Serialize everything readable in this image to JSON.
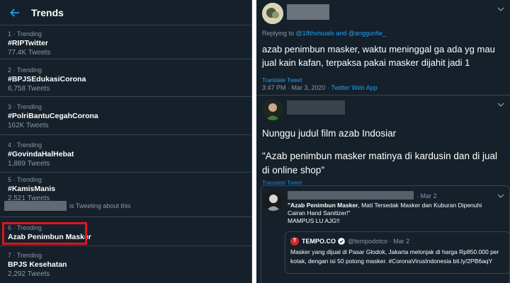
{
  "left": {
    "title": "Trends",
    "trends": [
      {
        "meta": "1 · Trending",
        "name": "#RIPTwitter",
        "count": "77.4K Tweets"
      },
      {
        "meta": "2 · Trending",
        "name": "#BPJSEdukasiCorona",
        "count": "6,758 Tweets"
      },
      {
        "meta": "3 · Trending",
        "name": "#PolriBantuCegahCorona",
        "count": "162K Tweets"
      },
      {
        "meta": "4 · Trending",
        "name": "#GovindaHalHebat",
        "count": "1,889 Tweets"
      },
      {
        "meta": "5 · Trending",
        "name": "#KamisManis",
        "count": "2,521 Tweets",
        "extra": "is Tweeting about this"
      },
      {
        "meta": "6 · Trending",
        "name": "Azab Penimbun Masker",
        "count": ""
      },
      {
        "meta": "7 · Trending",
        "name": "BPJS Kesehatan",
        "count": "2,292 Tweets"
      }
    ]
  },
  "right": {
    "tweet1": {
      "replying_prefix": "Replying to",
      "replying_handles": "@18thvisuals and @anggunfw_",
      "text": "azab penimbun masker, waktu meninggal ga ada yg mau jual kain kafan, terpaksa pakai masker dijahit jadi 1",
      "translate": "Translate Tweet",
      "timestamp": "3:47 PM · Mar 3, 2020 · ",
      "source": "Twitter Web App"
    },
    "tweet2": {
      "line1": "Nunggu judul film azab Indosiar",
      "line2": "\"Azab penimbun masker matinya di kardusin dan di jual di online shop\"",
      "translate": "Translate Tweet"
    },
    "quote": {
      "date": "· Mar 2",
      "bold": "\"Azab Penimbun Masker",
      "text": ", Mati Tersedak Masker dan Kuburan  Dipenuhi Cairan Hand Sanitizer!\"",
      "line2": "MAMPUS LU AJG!!"
    },
    "inner": {
      "logo": "T",
      "name": "TEMPO.CO",
      "handle": "@tempodotco · Mar 2",
      "text": "Masker yang dijual di Pasar Glodok, Jakarta melonjak di harga Rp850.000 per kotak, dengan isi 50 potong masker. #CoronaVirusIndonesia bit.ly/2PB6aqY"
    }
  }
}
